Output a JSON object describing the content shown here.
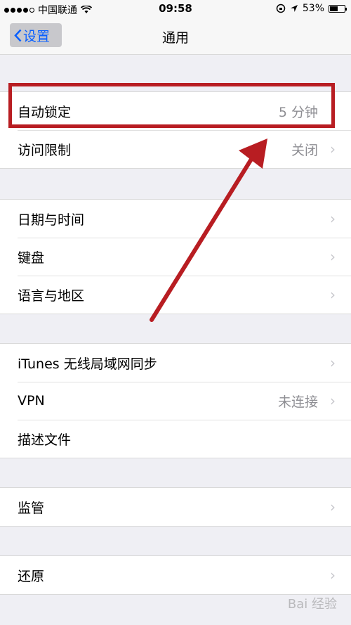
{
  "status_bar": {
    "carrier": "中国联通",
    "time": "09:58",
    "battery": "53%"
  },
  "nav": {
    "back_label": "设置",
    "title": "通用"
  },
  "groups": [
    {
      "rows": [
        {
          "label": "自动锁定",
          "value": "5 分钟"
        },
        {
          "label": "访问限制",
          "value": "关闭"
        }
      ]
    },
    {
      "rows": [
        {
          "label": "日期与时间",
          "value": ""
        },
        {
          "label": "键盘",
          "value": ""
        },
        {
          "label": "语言与地区",
          "value": ""
        }
      ]
    },
    {
      "rows": [
        {
          "label": "iTunes 无线局域网同步",
          "value": ""
        },
        {
          "label": "VPN",
          "value": "未连接"
        },
        {
          "label": "描述文件",
          "value": ""
        }
      ]
    },
    {
      "rows": [
        {
          "label": "监管",
          "value": ""
        }
      ]
    },
    {
      "rows": [
        {
          "label": "还原",
          "value": ""
        }
      ]
    }
  ],
  "annotation_color": "#b81d22",
  "watermark": "Bai 经验"
}
